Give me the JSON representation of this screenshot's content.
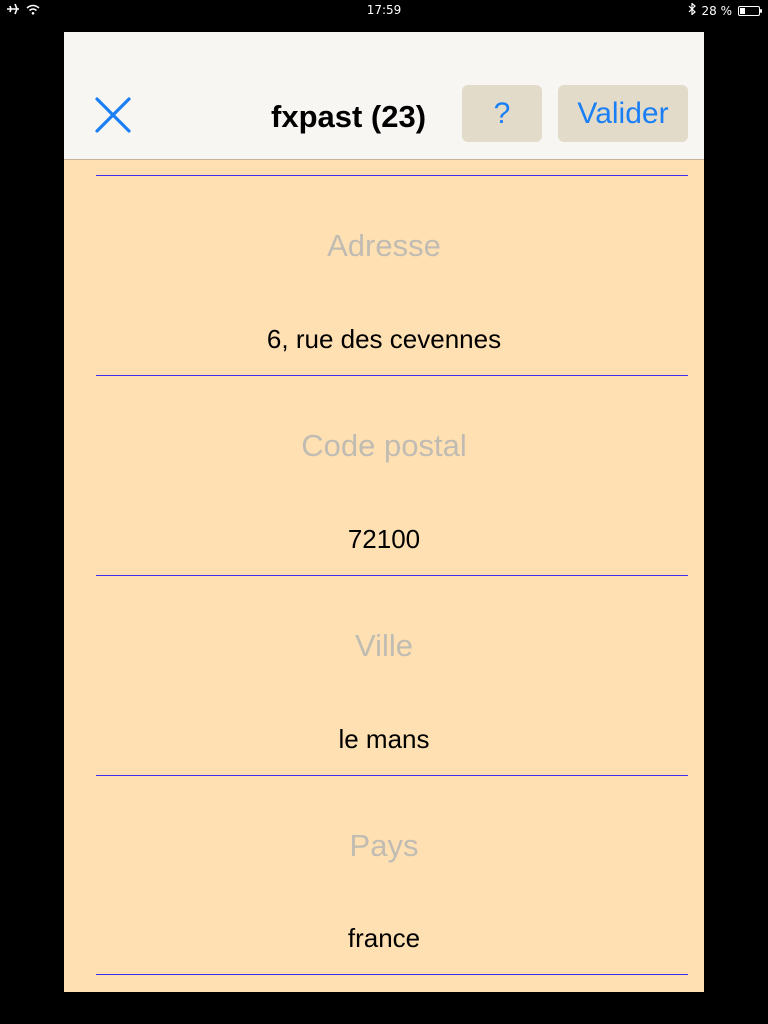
{
  "status_bar": {
    "time": "17:59",
    "battery_text": "28 %",
    "battery_level": 0.28
  },
  "nav": {
    "title": "fxpast (23)",
    "help_label": "?",
    "validate_label": "Valider",
    "accent_color": "#1a7ff6"
  },
  "form": {
    "fields": [
      {
        "label": "Adresse",
        "value": "6, rue des cevennes"
      },
      {
        "label": "Code postal",
        "value": "72100"
      },
      {
        "label": "Ville",
        "value": "le mans"
      },
      {
        "label": "Pays",
        "value": "france"
      }
    ]
  }
}
